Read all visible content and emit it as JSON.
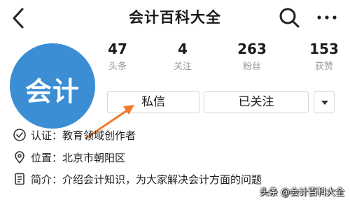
{
  "header": {
    "title": "会计百科大全"
  },
  "avatar": {
    "text": "会计",
    "color": "#3b8ed4"
  },
  "stats": [
    {
      "value": "47",
      "label": "头条"
    },
    {
      "value": "4",
      "label": "关注"
    },
    {
      "value": "263",
      "label": "粉丝"
    },
    {
      "value": "153",
      "label": "获赞"
    }
  ],
  "actions": {
    "message_label": "私信",
    "follow_label": "已关注"
  },
  "info": {
    "verification": "认证：教育领域创作者",
    "location": "位置：北京市朝阳区",
    "intro": "简介：介绍会计知识，为大家解决会计方面的问题"
  },
  "icons": {
    "back": "back-arrow-icon",
    "search": "search-icon",
    "more": "more-dots-icon",
    "verification": "verified-badge-icon",
    "location": "location-pin-icon",
    "intro": "document-icon",
    "dropdown": "chevron-down-icon"
  },
  "annotation_color": "#f07a2a",
  "watermark": "头条 @会计百科大全"
}
